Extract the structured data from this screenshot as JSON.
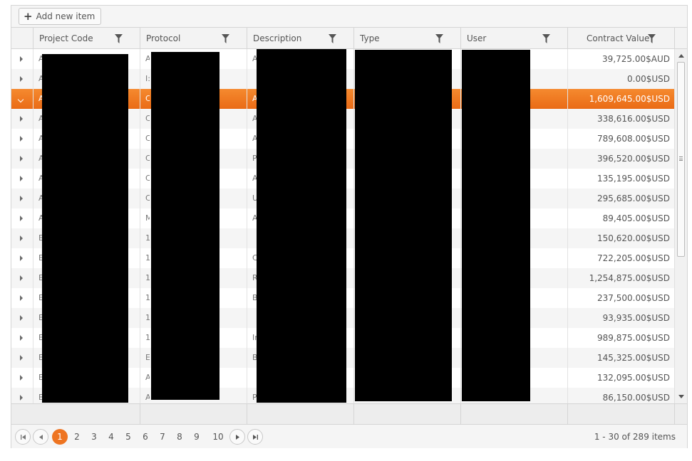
{
  "toolbar": {
    "add_label": "Add new item"
  },
  "columns": [
    {
      "label": "Project Code"
    },
    {
      "label": "Protocol"
    },
    {
      "label": "Description"
    },
    {
      "label": "Type"
    },
    {
      "label": "User"
    },
    {
      "label": "Contract Value"
    }
  ],
  "rows": [
    {
      "c1": "A",
      "c2": "A",
      "c3": "A",
      "value": "39,725.00$AUD"
    },
    {
      "c1": "A",
      "c2": "I:",
      "c3": "",
      "value": "0.00$USD"
    },
    {
      "c1": "A",
      "c2": "C",
      "c3": "A",
      "value": "1,609,645.00$USD",
      "selected": true
    },
    {
      "c1": "A",
      "c2": "C",
      "c3": "A",
      "value": "338,616.00$USD"
    },
    {
      "c1": "A",
      "c2": "C",
      "c3": "A",
      "value": "789,608.00$USD"
    },
    {
      "c1": "A",
      "c2": "C",
      "c3": "P",
      "value": "396,520.00$USD"
    },
    {
      "c1": "A",
      "c2": "C",
      "c3": "A",
      "value": "135,195.00$USD"
    },
    {
      "c1": "A",
      "c2": "C",
      "c3": "U",
      "value": "295,685.00$USD"
    },
    {
      "c1": "A",
      "c2": "M",
      "c3": "A",
      "value": "89,405.00$USD"
    },
    {
      "c1": "E",
      "c2": "1",
      "c3": "",
      "value": "150,620.00$USD"
    },
    {
      "c1": "E",
      "c2": "1",
      "c3": "C",
      "value": "722,205.00$USD"
    },
    {
      "c1": "E",
      "c2": "1",
      "c3": "R",
      "value": "1,254,875.00$USD"
    },
    {
      "c1": "E",
      "c2": "1",
      "c3": "B",
      "value": "237,500.00$USD"
    },
    {
      "c1": "E",
      "c2": "1",
      "c3": "",
      "value": "93,935.00$USD"
    },
    {
      "c1": "E",
      "c2": "1",
      "c3": "Ir",
      "value": "989,875.00$USD"
    },
    {
      "c1": "E",
      "c2": "E",
      "c3": "B",
      "value": "145,325.00$USD"
    },
    {
      "c1": "E",
      "c2": "A",
      "c3": "",
      "value": "132,095.00$USD"
    },
    {
      "c1": "E",
      "c2": "A",
      "c3": "P",
      "value": "86,150.00$USD"
    }
  ],
  "pager": {
    "pages": [
      "1",
      "2",
      "3",
      "4",
      "5",
      "6",
      "7",
      "8",
      "9",
      "10"
    ],
    "current": "1",
    "info": "1 - 30 of 289 items"
  },
  "icons": {
    "add": "plus-icon",
    "filter": "filter-icon",
    "expand": "caret-right-icon",
    "collapse": "caret-down-icon",
    "first": "first-page-icon",
    "prev": "prev-page-icon",
    "next": "next-page-icon",
    "last": "last-page-icon"
  },
  "colors": {
    "accent": "#ee7421",
    "selected_row": "#f07a25"
  }
}
